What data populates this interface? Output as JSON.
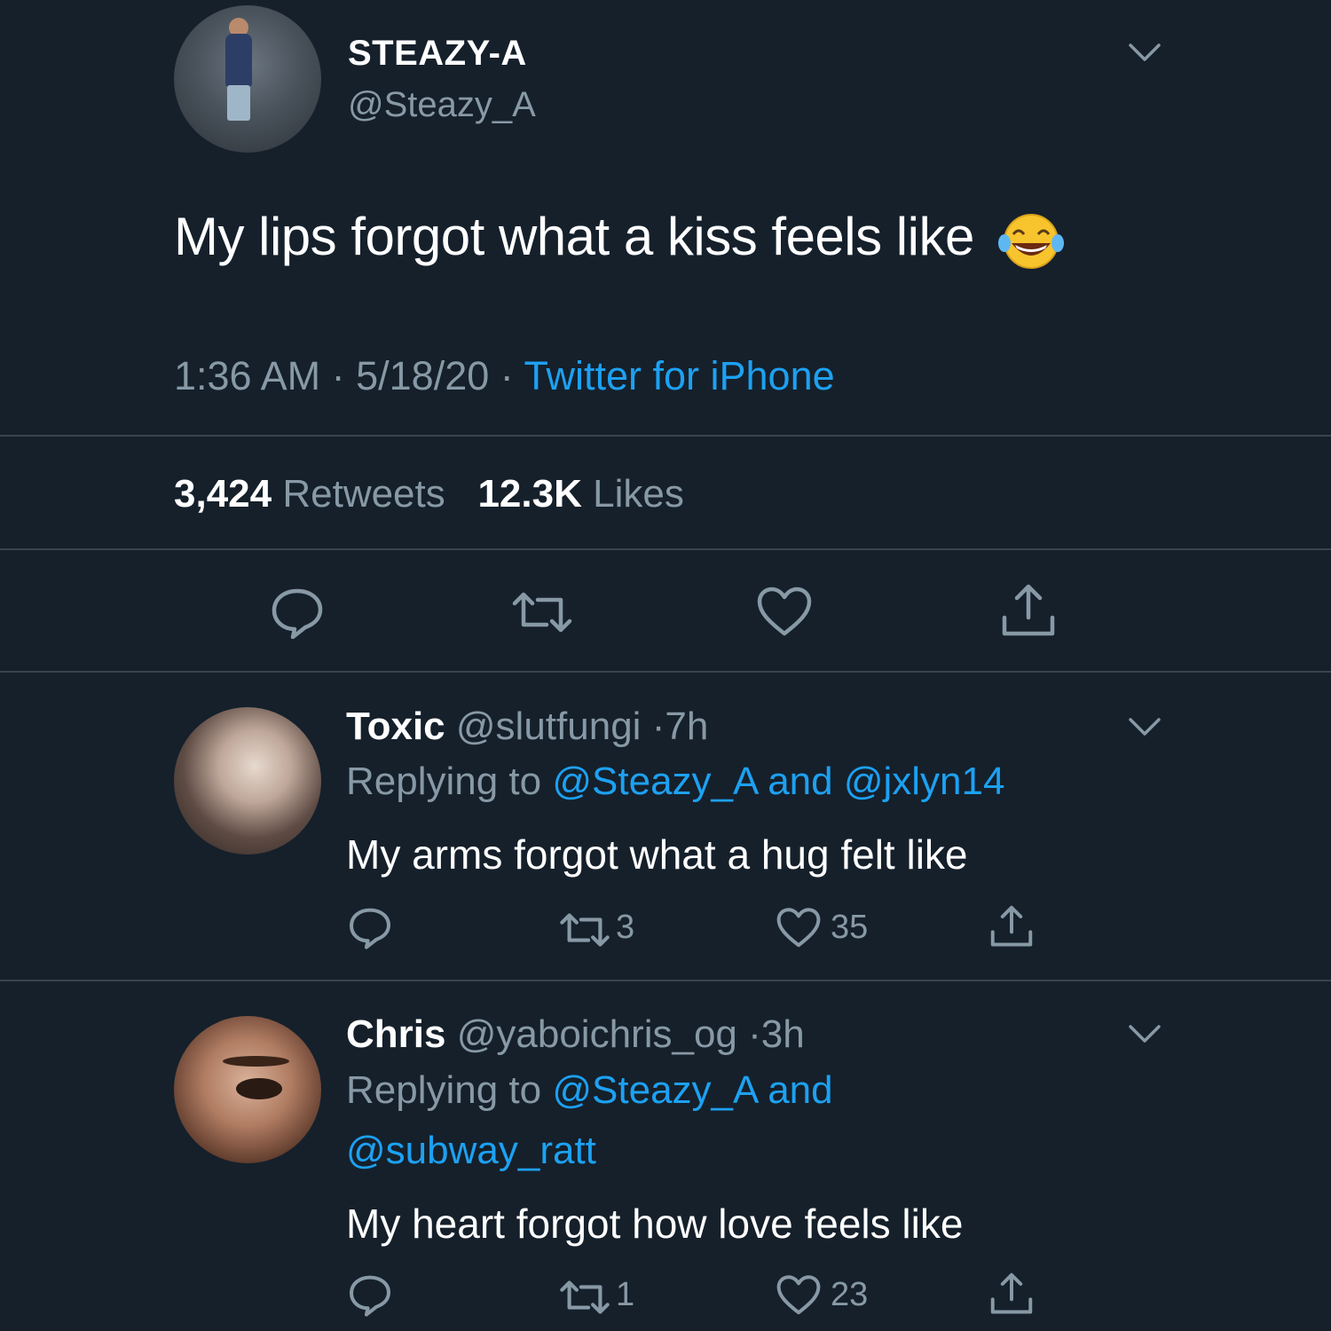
{
  "tweet": {
    "display_name": "STEAZY-A",
    "handle": "@Steazy_A",
    "text": "My lips forgot what a kiss feels like",
    "emoji": "face-with-tears-of-joy",
    "time": "1:36 AM",
    "date": "5/18/20",
    "source": "Twitter for iPhone",
    "retweets_count": "3,424",
    "retweets_label": "Retweets",
    "likes_count": "12.3K",
    "likes_label": "Likes"
  },
  "replies": [
    {
      "name": "Toxic",
      "handle": "@slutfungi",
      "age": "7h",
      "replying_prefix": "Replying to",
      "replying_to_1": "@Steazy_A",
      "replying_and": "and",
      "replying_to_2": "@jxlyn14",
      "text": "My arms forgot what a hug felt like",
      "retweets": "3",
      "likes": "35"
    },
    {
      "name": "Chris",
      "handle": "@yaboichris_og",
      "age": "3h",
      "replying_prefix": "Replying to",
      "replying_to_1": "@Steazy_A",
      "replying_and": "and",
      "replying_to_2": "@subway_ratt",
      "text": "My heart forgot how love feels like",
      "retweets": "1",
      "likes": "23"
    }
  ],
  "colors": {
    "background": "#15202b",
    "muted": "#8899a6",
    "link": "#1da1f2",
    "divider": "#38444d"
  }
}
